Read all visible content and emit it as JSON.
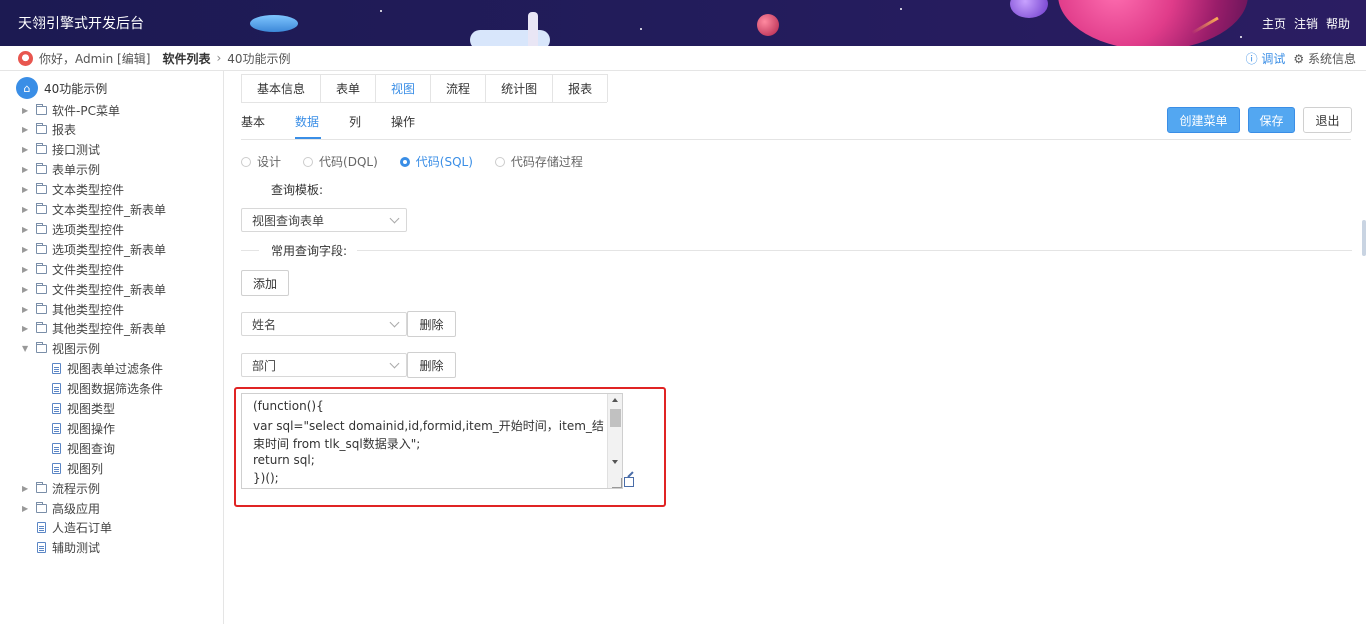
{
  "header": {
    "app_title": "天翎引擎式开发后台",
    "links": {
      "home": "主页",
      "logout": "注销",
      "help": "帮助"
    }
  },
  "crumb": {
    "greeting": "你好，Admin [编辑]",
    "software_list": "软件列表",
    "separator": "›",
    "current": "40功能示例",
    "debug": "ⓘ 调试",
    "sysinfo": "⚙ 系统信息"
  },
  "tree": {
    "root": "40功能示例",
    "items": [
      {
        "label": "软件-PC菜单",
        "type": "folder",
        "expanded": false
      },
      {
        "label": "报表",
        "type": "folder",
        "expanded": false
      },
      {
        "label": "接口测试",
        "type": "folder",
        "expanded": false
      },
      {
        "label": "表单示例",
        "type": "folder",
        "expanded": false
      },
      {
        "label": "文本类型控件",
        "type": "folder",
        "expanded": false
      },
      {
        "label": "文本类型控件_新表单",
        "type": "folder",
        "expanded": false
      },
      {
        "label": "选项类型控件",
        "type": "folder",
        "expanded": false
      },
      {
        "label": "选项类型控件_新表单",
        "type": "folder",
        "expanded": false
      },
      {
        "label": "文件类型控件",
        "type": "folder",
        "expanded": false
      },
      {
        "label": "文件类型控件_新表单",
        "type": "folder",
        "expanded": false
      },
      {
        "label": "其他类型控件",
        "type": "folder",
        "expanded": false
      },
      {
        "label": "其他类型控件_新表单",
        "type": "folder",
        "expanded": false
      },
      {
        "label": "视图示例",
        "type": "folder",
        "expanded": true
      },
      {
        "label": "视图表单过滤条件",
        "type": "file",
        "child": true
      },
      {
        "label": "视图数据筛选条件",
        "type": "file",
        "child": true
      },
      {
        "label": "视图类型",
        "type": "file",
        "child": true
      },
      {
        "label": "视图操作",
        "type": "file",
        "child": true
      },
      {
        "label": "视图查询",
        "type": "file",
        "child": true
      },
      {
        "label": "视图列",
        "type": "file",
        "child": true
      },
      {
        "label": "流程示例",
        "type": "folder",
        "expanded": false
      },
      {
        "label": "高级应用",
        "type": "folder",
        "expanded": false
      },
      {
        "label": "人造石订单",
        "type": "file",
        "child": false
      },
      {
        "label": "辅助测试",
        "type": "file",
        "child": false
      }
    ]
  },
  "tabs": [
    "基本信息",
    "表单",
    "视图",
    "流程",
    "统计图",
    "报表"
  ],
  "active_tab": "视图",
  "subtabs": [
    "基本",
    "数据",
    "列",
    "操作"
  ],
  "active_subtab": "数据",
  "buttons": {
    "create_menu": "创建菜单",
    "save": "保存",
    "exit": "退出"
  },
  "radios": [
    {
      "label": "设计",
      "checked": false
    },
    {
      "label": "代码(DQL)",
      "checked": false
    },
    {
      "label": "代码(SQL)",
      "checked": true
    },
    {
      "label": "代码存储过程",
      "checked": false
    }
  ],
  "form": {
    "query_template_label": "查询模板:",
    "query_template_value": "视图查询表单",
    "common_fields_label": "常用查询字段:",
    "add_button": "添加",
    "fields": [
      {
        "value": "姓名",
        "delete": "删除"
      },
      {
        "value": "部门",
        "delete": "删除"
      }
    ]
  },
  "code": {
    "lines": [
      "(function(){",
      "var sql=\"select domainid,id,formid,item_开始时间，item_结",
      "束时间 from tlk_sql数据录入\";",
      "return sql;",
      "})();"
    ]
  },
  "colors": {
    "accent": "#3a8ee6",
    "header_bg": "#1c1a52",
    "highlight": "#e02424"
  }
}
